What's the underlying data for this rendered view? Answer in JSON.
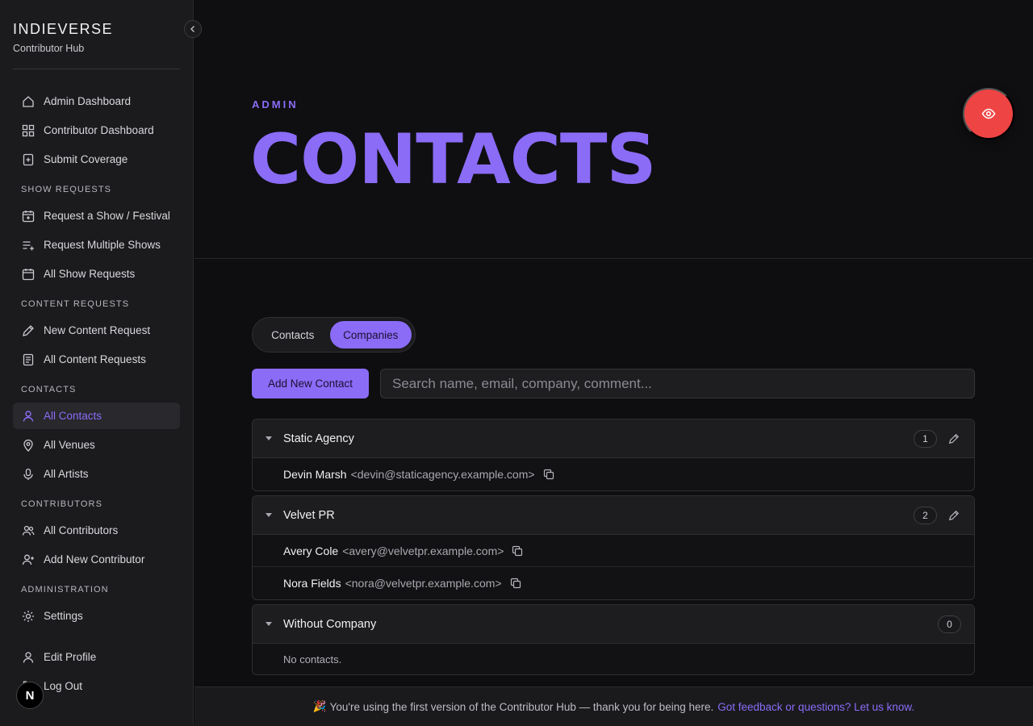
{
  "brand": {
    "title": "INDIEVERSE",
    "subtitle": "Contributor Hub"
  },
  "sidebar": {
    "top_items": [
      {
        "label": "Admin Dashboard",
        "icon": "home-icon"
      },
      {
        "label": "Contributor Dashboard",
        "icon": "grid-icon"
      },
      {
        "label": "Submit Coverage",
        "icon": "file-plus-icon"
      }
    ],
    "sections": [
      {
        "title": "SHOW REQUESTS",
        "items": [
          {
            "label": "Request a Show / Festival",
            "icon": "calendar-plus-icon"
          },
          {
            "label": "Request Multiple Shows",
            "icon": "list-plus-icon"
          },
          {
            "label": "All Show Requests",
            "icon": "calendar-icon"
          }
        ]
      },
      {
        "title": "CONTENT REQUESTS",
        "items": [
          {
            "label": "New Content Request",
            "icon": "pencil-icon"
          },
          {
            "label": "All Content Requests",
            "icon": "document-icon"
          }
        ]
      },
      {
        "title": "CONTACTS",
        "items": [
          {
            "label": "All Contacts",
            "icon": "user-icon",
            "active": true
          },
          {
            "label": "All Venues",
            "icon": "map-pin-icon"
          },
          {
            "label": "All Artists",
            "icon": "microphone-icon"
          }
        ]
      },
      {
        "title": "CONTRIBUTORS",
        "items": [
          {
            "label": "All Contributors",
            "icon": "users-icon"
          },
          {
            "label": "Add New Contributor",
            "icon": "user-plus-icon"
          }
        ]
      },
      {
        "title": "ADMINISTRATION",
        "items": [
          {
            "label": "Settings",
            "icon": "gear-icon"
          }
        ]
      }
    ],
    "bottom_items": [
      {
        "label": "Edit Profile",
        "icon": "user-icon"
      },
      {
        "label": "Log Out",
        "icon": "logout-icon"
      }
    ],
    "avatar_letter": "N"
  },
  "header": {
    "eyebrow": "ADMIN",
    "title": "CONTACTS"
  },
  "tabs": {
    "contacts": "Contacts",
    "companies": "Companies",
    "selected": "Companies"
  },
  "toolbar": {
    "add_label": "Add New Contact",
    "search_placeholder": "Search name, email, company, comment..."
  },
  "groups": [
    {
      "name": "Static Agency",
      "count": "1",
      "editable": true,
      "contacts": [
        {
          "name": "Devin Marsh",
          "email": "<devin@staticagency.example.com>"
        }
      ]
    },
    {
      "name": "Velvet PR",
      "count": "2",
      "editable": true,
      "contacts": [
        {
          "name": "Avery Cole",
          "email": "<avery@velvetpr.example.com>"
        },
        {
          "name": "Nora Fields",
          "email": "<nora@velvetpr.example.com>"
        }
      ]
    },
    {
      "name": "Without Company",
      "count": "0",
      "editable": false,
      "contacts": [],
      "empty_text": "No contacts."
    }
  ],
  "footer": {
    "emoji": "🎉",
    "text": "You're using the first version of the Contributor Hub — thank you for being here.",
    "link": "Got feedback or questions? Let us know."
  },
  "colors": {
    "accent": "#8b6cf7",
    "danger": "#ef4444",
    "sidebar_bg": "#1b1b1e",
    "page_bg": "#0e0e10"
  }
}
